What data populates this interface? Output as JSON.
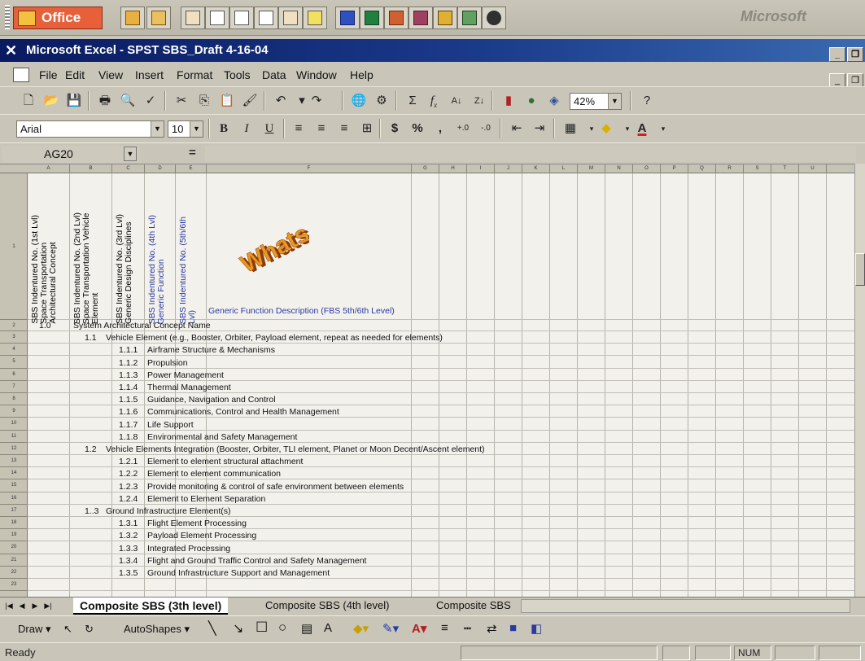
{
  "office_bar": {
    "logo_label": "Office",
    "brand": "Microsoft"
  },
  "window": {
    "title": "Microsoft Excel - SPST SBS_Draft 4-16-04",
    "app_icon": "excel-x-icon"
  },
  "menu": {
    "items": [
      "File",
      "Edit",
      "View",
      "Insert",
      "Format",
      "Tools",
      "Data",
      "Window",
      "Help"
    ]
  },
  "standard_toolbar": {
    "zoom": "42%",
    "sigma": "Σ",
    "fx": "f",
    "fx_sub": "x"
  },
  "format_toolbar": {
    "font_name": "Arial",
    "font_size": "10",
    "bold": "B",
    "italic": "I",
    "underline": "U",
    "currency": "$",
    "percent": "%",
    "comma": ",",
    "font_color": "A"
  },
  "formula_bar": {
    "name_box": "AG20",
    "equals": "="
  },
  "sheet": {
    "column_headers": [
      "A",
      "B",
      "C",
      "D",
      "E",
      "F",
      "G",
      "H",
      "I",
      "J",
      "K",
      "L",
      "M",
      "N",
      "O",
      "P",
      "Q",
      "R",
      "S",
      "T",
      "U"
    ],
    "row_numbers": [
      "1",
      "2",
      "3",
      "4",
      "5",
      "6",
      "7",
      "8",
      "9",
      "10",
      "11",
      "12",
      "13",
      "14",
      "15",
      "16",
      "17",
      "18",
      "19",
      "20",
      "21",
      "22",
      "23"
    ],
    "header_labels": [
      "SBS Indentured No. (1st Lvl)\nSpace Transportation\nArchitectural Concept",
      "SBS Indentured No. (2nd Lvl)\nSpace Transportation Vehicle\nElement",
      "SBS Indentured No. (3rd Lvl)\nGeneric Design Disciplines",
      "SBS Indentured No. (4th Lvl)\nGeneric Function",
      "SBS Indentured No. (5th/6th\nLvl)"
    ],
    "function_desc_header": "Generic Function Description (FBS 5th/6th Level)",
    "whats_art": "Whats",
    "rows": [
      {
        "num": "1.0",
        "level": 1,
        "text": "System Architectural Concept Name"
      },
      {
        "num": "1.1",
        "level": 2,
        "text": "Vehicle Element (e.g., Booster, Orbiter, Payload element, repeat as needed for elements)"
      },
      {
        "num": "1.1.1",
        "level": 3,
        "text": "Airframe Structure & Mechanisms"
      },
      {
        "num": "1.1.2",
        "level": 3,
        "text": "Propulsion"
      },
      {
        "num": "1.1.3",
        "level": 3,
        "text": "Power Management"
      },
      {
        "num": "1.1.4",
        "level": 3,
        "text": "Thermal Management"
      },
      {
        "num": "1.1.5",
        "level": 3,
        "text": "Guidance, Navigation and Control"
      },
      {
        "num": "1.1.6",
        "level": 3,
        "text": "Communications, Control and Health Management"
      },
      {
        "num": "1.1.7",
        "level": 3,
        "text": "Life Support"
      },
      {
        "num": "1.1.8",
        "level": 3,
        "text": "Environmental and Safety Management"
      },
      {
        "num": "1.2",
        "level": 2,
        "text": "Vehicle Elements Integration (Booster, Orbiter, TLI element, Planet or Moon Decent/Ascent element)"
      },
      {
        "num": "1.2.1",
        "level": 3,
        "text": "Element to element structural attachment"
      },
      {
        "num": "1.2.2",
        "level": 3,
        "text": "Element to element communication"
      },
      {
        "num": "1.2.3",
        "level": 3,
        "text": "Provide monitoring & control of safe environment between elements"
      },
      {
        "num": "1.2.4",
        "level": 3,
        "text": "Element to Element Separation"
      },
      {
        "num": "1..3",
        "level": 2,
        "text": "Ground Infrastructure Element(s)"
      },
      {
        "num": "1.3.1",
        "level": 3,
        "text": "Flight Element Processing"
      },
      {
        "num": "1.3.2",
        "level": 3,
        "text": "Payload Element Processing"
      },
      {
        "num": "1.3.3",
        "level": 3,
        "text": "Integrated Processing"
      },
      {
        "num": "1.3.4",
        "level": 3,
        "text": "Flight and Ground Traffic Control and Safety Management"
      },
      {
        "num": "1.3.5",
        "level": 3,
        "text": "Ground Infrastructure Support and Management"
      }
    ]
  },
  "tabs": [
    "Composite SBS (3th level)",
    "Composite SBS (4th level)",
    "Composite SBS"
  ],
  "drawing_toolbar": {
    "draw": "Draw",
    "autoshapes": "AutoShapes"
  },
  "status": {
    "ready": "Ready",
    "num": "NUM"
  },
  "colors": {
    "title_bar": "#0a1a60",
    "header_blue_text": "#2a3aa0",
    "office_orange": "#e8603a",
    "whats_orange": "#e07a18"
  }
}
